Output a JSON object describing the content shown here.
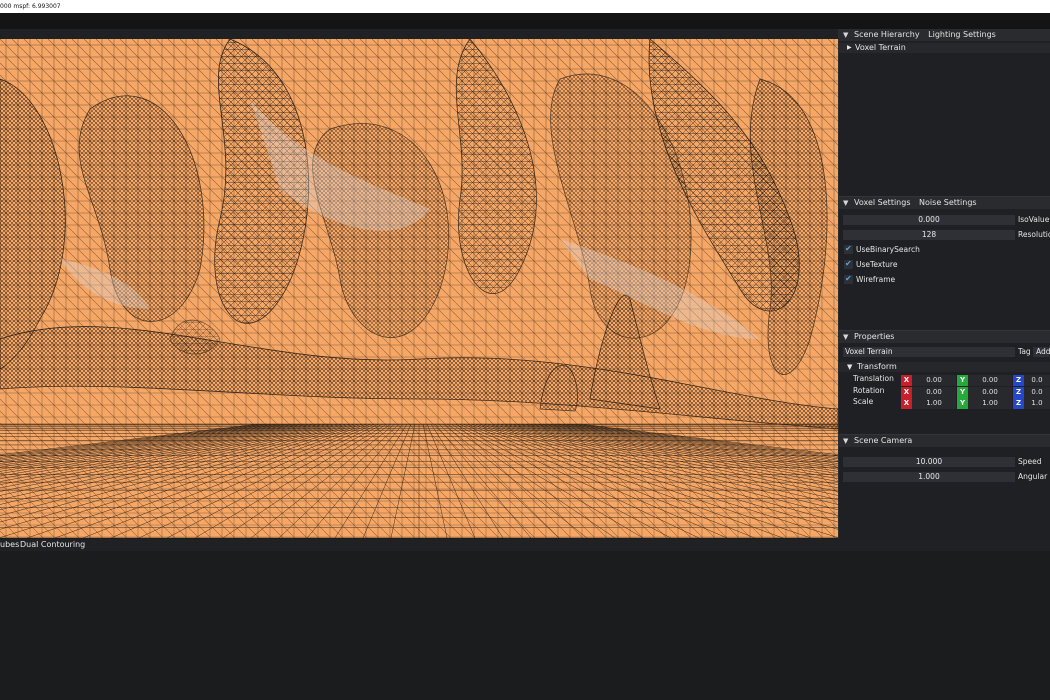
{
  "titlebar": {
    "text": "000   mspf: 6.993007"
  },
  "panels": {
    "hierarchy": {
      "tabs": [
        "Scene Hierarchy",
        "Lighting Settings"
      ],
      "items": [
        {
          "label": "Voxel Terrain"
        }
      ]
    },
    "voxel": {
      "tabs": [
        "Voxel Settings",
        "Noise Settings"
      ],
      "fields": [
        {
          "value": "0.000",
          "label": "IsoValue"
        },
        {
          "value": "128",
          "label": "Resolutio"
        }
      ],
      "checks": [
        {
          "label": "UseBinarySearch",
          "checked": true
        },
        {
          "label": "UseTexture",
          "checked": true
        },
        {
          "label": "Wireframe",
          "checked": true
        }
      ]
    },
    "properties": {
      "title": "Properties",
      "name_value": "Voxel Terrain",
      "tag_label": "Tag",
      "add_label": "Add",
      "transform_label": "Transform",
      "rows": [
        {
          "label": "Translation",
          "x": "0.00",
          "y": "0.00",
          "z": "0.0"
        },
        {
          "label": "Rotation",
          "x": "0.00",
          "y": "0.00",
          "z": "0.0"
        },
        {
          "label": "Scale",
          "x": "1.00",
          "y": "1.00",
          "z": "1.0"
        }
      ],
      "axis_letters": {
        "x": "X",
        "y": "Y",
        "z": "Z"
      }
    },
    "camera": {
      "title": "Scene Camera",
      "fields": [
        {
          "value": "10.000",
          "label": "Speed"
        },
        {
          "value": "1.000",
          "label": "Angular S"
        }
      ]
    }
  },
  "bottom_tabs": [
    "ubes",
    "Dual Contouring"
  ],
  "colors": {
    "terrain": "#f7a765",
    "wire": "#1a140e",
    "axis_x": "#c8202a",
    "axis_y": "#28a83a",
    "axis_z": "#2448c6",
    "check": "#5aa2e6"
  },
  "icons": {
    "collapse": "triangle-down-icon",
    "expand": "triangle-right-icon",
    "check": "checkmark-icon"
  }
}
